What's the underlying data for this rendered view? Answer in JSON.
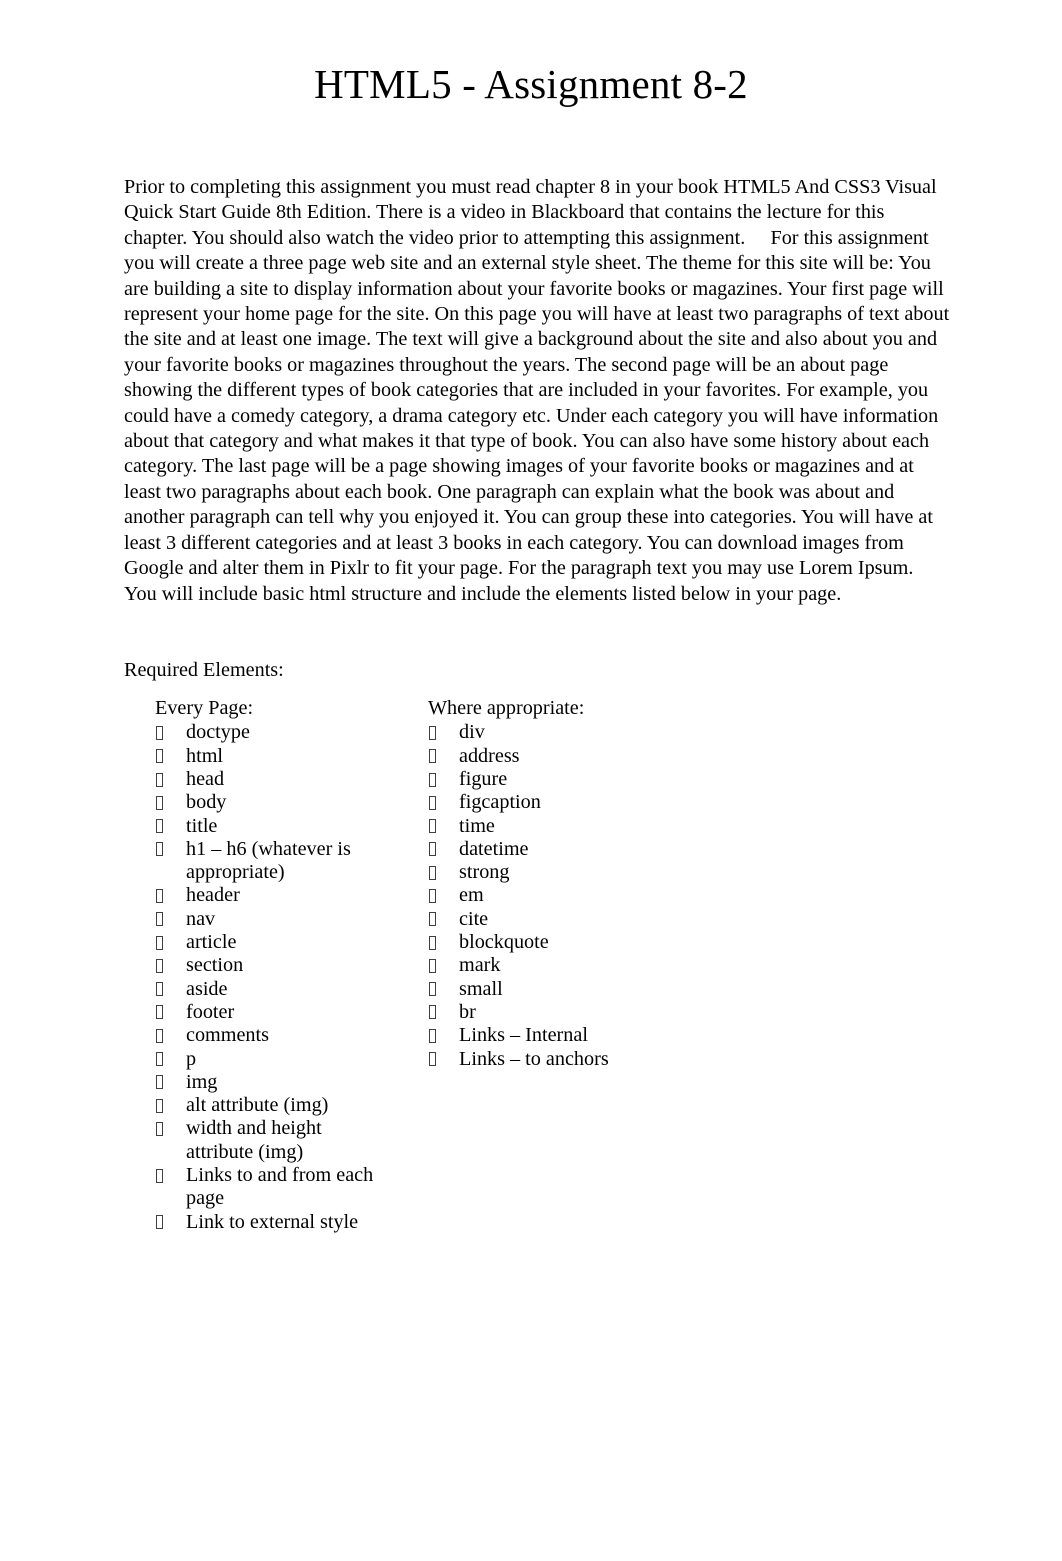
{
  "document": {
    "title": "HTML5 - Assignment 8-2",
    "body_paragraph": "Prior to completing this assignment you must read chapter 8 in your book HTML5 And CSS3 Visual Quick Start Guide 8th Edition. There is a video in Blackboard that contains the lecture for this chapter. You should also watch the video prior to attempting this assignment.     For this assignment you will create a three page web site and an external style sheet. The theme for this site will be: You are building a site to display information about your favorite books or magazines. Your first page will represent your home page for the site. On this page you will have at least two paragraphs of text about the site and at least one image. The text will give a background about the site and also about you and your favorite books or magazines throughout the years. The second page will be an about page showing the different types of book categories that are included in your favorites. For example, you could have a comedy category, a drama category etc. Under each category you will have information about that category and what makes it that type of book. You can also have some history about each category. The last page will be a page showing images of your favorite books or magazines and at least two paragraphs about each book. One paragraph can explain what the book was about and another paragraph can tell why you enjoyed it. You can group these into categories. You will have at least 3 different categories and at least 3 books in each category. You can download images from Google and alter them in Pixlr to fit your page. For the paragraph text you may use Lorem Ipsum. You will include basic html structure and include the elements listed below in your page.",
    "required_elements_heading": "Required Elements:",
    "bullet_glyph": "missing-glyph-box",
    "columns": [
      {
        "heading": "Every Page:",
        "items": [
          "doctype",
          "html",
          "head",
          "body",
          "title",
          "h1 – h6 (whatever is appropriate)",
          "header",
          "nav",
          "article",
          "section",
          "aside",
          "footer",
          "comments",
          "p",
          "img",
          "alt attribute (img)",
          "width and height attribute (img)",
          "Links to and from each page",
          "Link to external style"
        ]
      },
      {
        "heading": "Where appropriate:",
        "items": [
          "div",
          "address",
          "figure",
          "figcaption",
          "time",
          "datetime",
          "strong",
          "em",
          "cite",
          "blockquote",
          "mark",
          "small",
          "br",
          "Links – Internal",
          "Links – to anchors"
        ]
      }
    ]
  },
  "colors": {
    "page_background": "#ffffff",
    "text": "#000000",
    "bullet_outline": "#3f3f3f"
  }
}
